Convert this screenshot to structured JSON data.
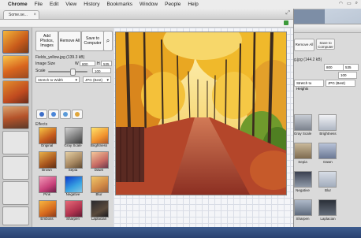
{
  "menubar": {
    "app": "Chrome",
    "items": [
      "File",
      "Edit",
      "View",
      "History",
      "Bookmarks",
      "Window",
      "People",
      "Help"
    ]
  },
  "tab": {
    "title": "Some.se..."
  },
  "controls": {
    "add_photos": "Add Photos, Images",
    "remove_all": "Remove All",
    "save": "Save to Computer",
    "filename": "Fields_yellow.jpg (139.3 kB)",
    "image_size_label": "Image Size",
    "width_label": "W",
    "width_value": "800",
    "height_label": "H",
    "height_value": "535",
    "scale_label": "Scale",
    "scale_value": "100",
    "scale_percent": 0.6,
    "mode_select": "Stretch to Width",
    "format_select": "JPG (Best)",
    "effects_heading": "Effects"
  },
  "effects": [
    {
      "name": "Original"
    },
    {
      "name": "Gray Scale"
    },
    {
      "name": "Brightness"
    },
    {
      "name": "Brown"
    },
    {
      "name": "Sepia"
    },
    {
      "name": "Dawn"
    },
    {
      "name": "Pink"
    },
    {
      "name": "Negative"
    },
    {
      "name": "Blur"
    },
    {
      "name": "Emboss"
    },
    {
      "name": "Sharpen"
    },
    {
      "name": "Laplacian"
    }
  ],
  "bg_window": {
    "remove_all": "Remove All",
    "save": "Save to Computer",
    "filename": "g.jpg (144.2 kB)",
    "w_value": "800",
    "h_value": "535",
    "scale_value": "100",
    "mode_select": "Stretch to Heights",
    "format_select": "JPG (Best)",
    "effects": [
      "Gray Scale",
      "Brightness",
      "Sepia",
      "Dawn",
      "Negative",
      "Blur",
      "Sharpen",
      "Laplacian"
    ]
  },
  "colors": {
    "accent": "#3c6ec8",
    "photo_leaves": "#e3a21d"
  }
}
